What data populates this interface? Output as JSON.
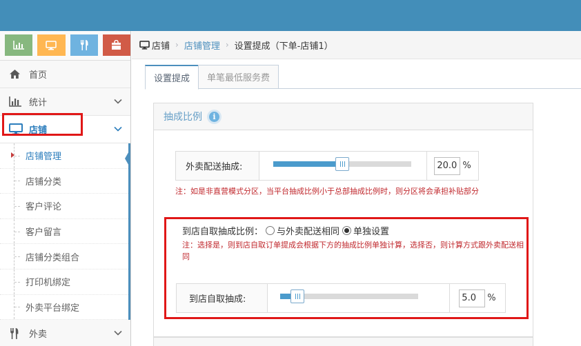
{
  "sidebar": {
    "shortcut_colors": [
      "#87b87f",
      "#ffb752",
      "#6fb3e0",
      "#d15b47"
    ],
    "shortcuts": [
      {
        "icon": "bar-chart-icon",
        "color": "#87b87f"
      },
      {
        "icon": "desktop-icon",
        "color": "#ffb752"
      },
      {
        "icon": "utensils-icon",
        "color": "#6fb3e0"
      },
      {
        "icon": "shopping-bag-icon",
        "color": "#d15b47"
      }
    ],
    "items": [
      {
        "label": "首页",
        "icon": "home-icon"
      },
      {
        "label": "统计",
        "icon": "bar-chart-icon"
      },
      {
        "label": "店铺",
        "icon": "desktop-icon"
      },
      {
        "label": "外卖",
        "icon": "utensils-icon"
      }
    ],
    "submenu": [
      "店铺管理",
      "店铺分类",
      "客户评论",
      "客户留言",
      "店铺分类组合",
      "打印机绑定",
      "外卖平台绑定"
    ]
  },
  "breadcrumb": {
    "home": "店铺",
    "parent": "店铺管理",
    "current": "设置提成（下单-店铺1）"
  },
  "tabs": [
    {
      "label": "设置提成",
      "active": true
    },
    {
      "label": "单笔最低服务费",
      "active": false
    }
  ],
  "panel": {
    "title": "抽成比例",
    "delivery": {
      "label": "外卖配送抽成:",
      "value": "20.0",
      "unit": "%",
      "fraction": 0.2
    },
    "delivery_note": "注：如是非直营模式分区，当平台抽成比例小于总部抽成比例时，则分区将会承担补贴部分",
    "pickup_mode": {
      "label": "到店自取抽成比例：",
      "options": [
        "与外卖配送相同",
        "单独设置"
      ],
      "selected": 1
    },
    "pickup_note": "注：选择是，则到店自取订单提成会根据下方的抽成比例单独计算，选择否，则计算方式跟外卖配送相同",
    "pickup": {
      "label": "到店自取抽成:",
      "value": "5.0",
      "unit": "%",
      "fraction": 0.05
    }
  },
  "colors": {
    "topbar": "#438eb9",
    "accent": "#4c8fbd",
    "note": "#c0282d",
    "highlight": "#e01717"
  }
}
